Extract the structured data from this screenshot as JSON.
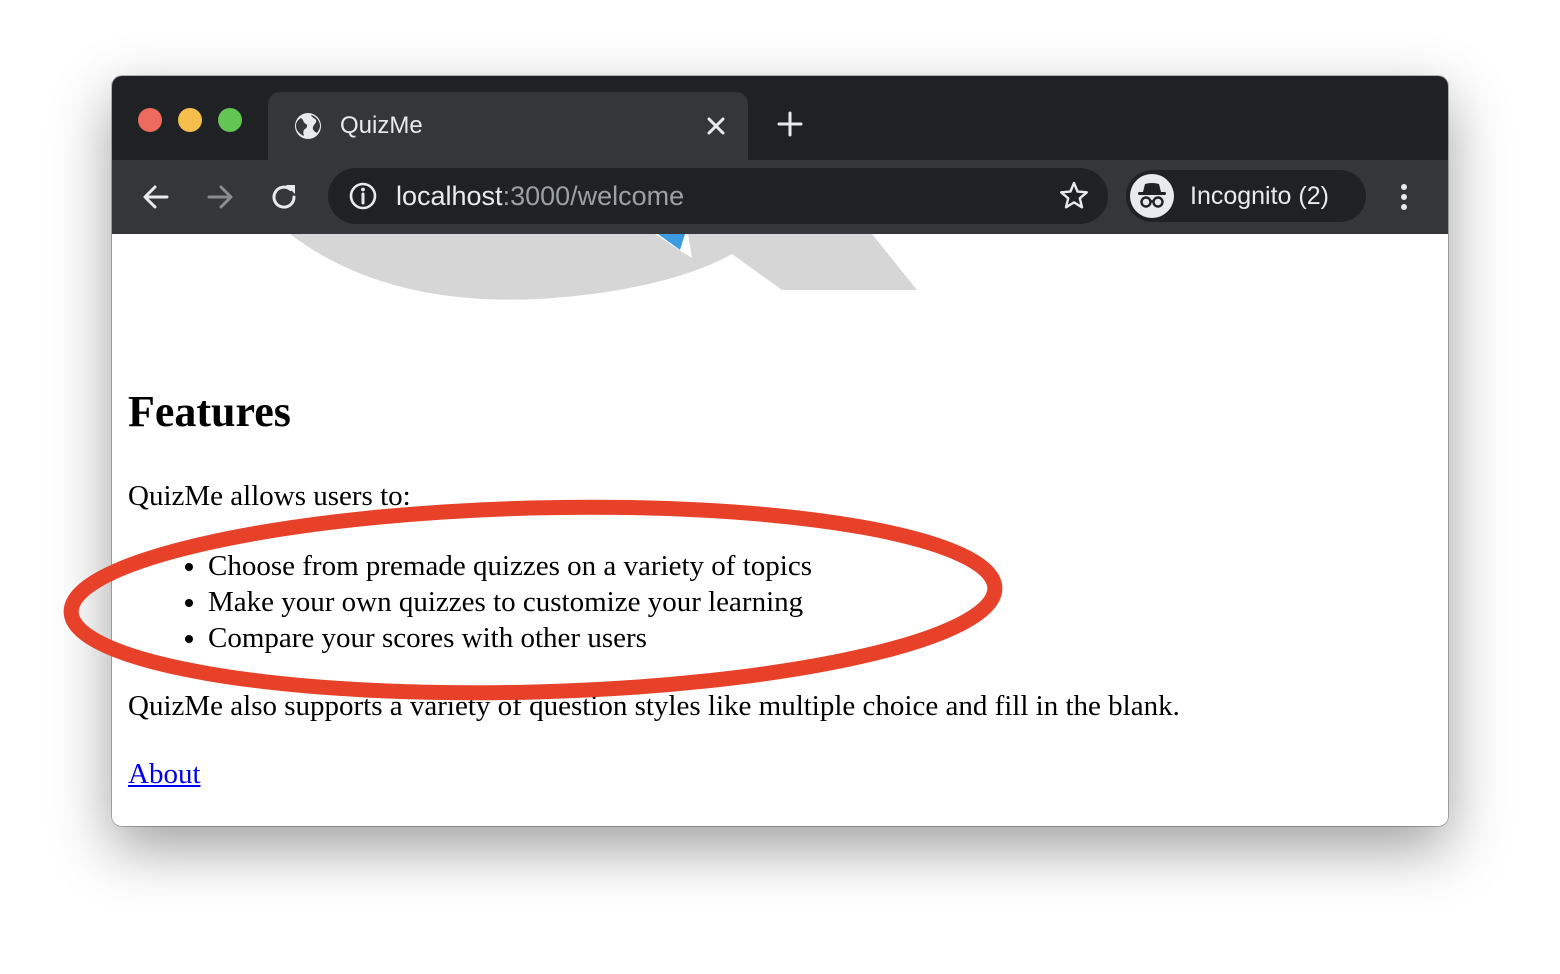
{
  "browser": {
    "tab": {
      "title": "QuizMe"
    },
    "url": {
      "host": "localhost",
      "rest": ":3000/welcome"
    },
    "profile": {
      "label": "Incognito (2)"
    },
    "colors": {
      "traffic_close": "#ed6a5e",
      "traffic_min": "#f5bf4f",
      "traffic_max": "#62c554"
    },
    "icons": [
      "globe-icon",
      "close-icon",
      "plus-icon",
      "back-arrow-icon",
      "forward-arrow-icon",
      "reload-icon",
      "info-icon",
      "star-icon",
      "incognito-icon",
      "more-vert-icon"
    ]
  },
  "page": {
    "heading": "Features",
    "intro": "QuizMe allows users to:",
    "features": [
      "Choose from premade quizzes on a variety of topics",
      "Make your own quizzes to customize your learning",
      "Compare your scores with other users"
    ],
    "support_text": "QuizMe also supports a variety of question styles like multiple choice and fill in the blank.",
    "about_link": "About"
  },
  "annotation": {
    "color": "#e8412a"
  }
}
